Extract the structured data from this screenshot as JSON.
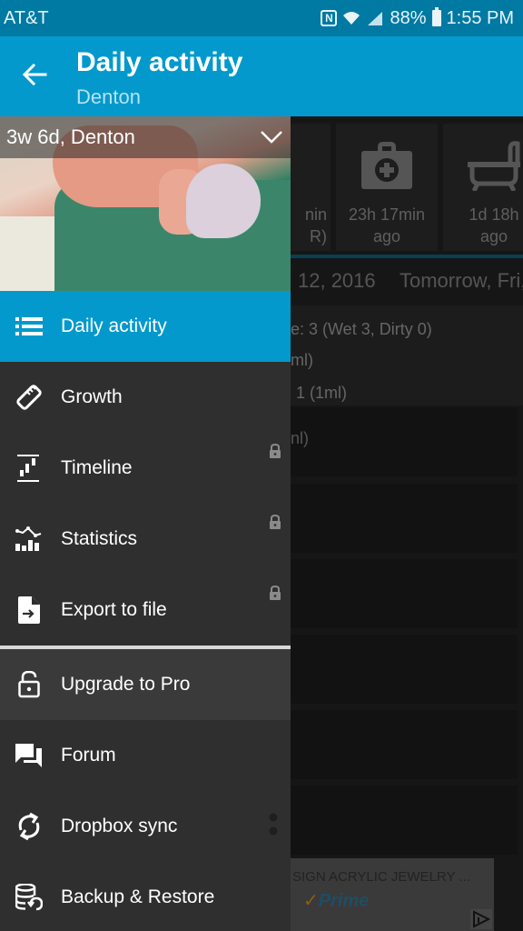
{
  "status_bar": {
    "carrier": "AT&T",
    "nfc_icon": "N",
    "battery": "88%",
    "time": "1:55 PM"
  },
  "toolbar": {
    "title": "Daily activity",
    "subtitle": "Denton",
    "back_icon": "arrow-back-icon"
  },
  "background": {
    "cards": [
      {
        "line1": "nin",
        "line2": "R)"
      },
      {
        "icon": "medicine-kit-icon",
        "line1": "23h 17min",
        "line2": "ago"
      },
      {
        "icon": "bathtub-icon",
        "line1": "1d 18h",
        "line2": "ago"
      }
    ],
    "date_current": "12, 2016",
    "date_next": "Tomorrow, Fri,",
    "summary": [
      "e: 3 (Wet 3, Dirty 0)",
      "ml)",
      "1 (1ml)"
    ],
    "row_texts": [
      "nl)",
      "",
      "",
      "",
      "",
      ""
    ]
  },
  "ad": {
    "text": "SIGN ACRYLIC JEWELRY ...",
    "brand": "Prime"
  },
  "drawer": {
    "child_label": "3w 6d, Denton",
    "items": [
      {
        "label": "Daily activity",
        "icon": "list-icon",
        "active": true,
        "locked": false
      },
      {
        "label": "Growth",
        "icon": "ruler-icon",
        "active": false,
        "locked": false
      },
      {
        "label": "Timeline",
        "icon": "timeline-icon",
        "active": false,
        "locked": true
      },
      {
        "label": "Statistics",
        "icon": "statistics-icon",
        "active": false,
        "locked": true
      },
      {
        "label": "Export to file",
        "icon": "export-file-icon",
        "active": false,
        "locked": true
      }
    ],
    "secondary_items": [
      {
        "label": "Upgrade to Pro",
        "icon": "unlock-icon"
      },
      {
        "label": "Forum",
        "icon": "forum-icon"
      },
      {
        "label": "Dropbox sync",
        "icon": "sync-icon"
      },
      {
        "label": "Backup & Restore",
        "icon": "backup-restore-icon"
      }
    ]
  }
}
